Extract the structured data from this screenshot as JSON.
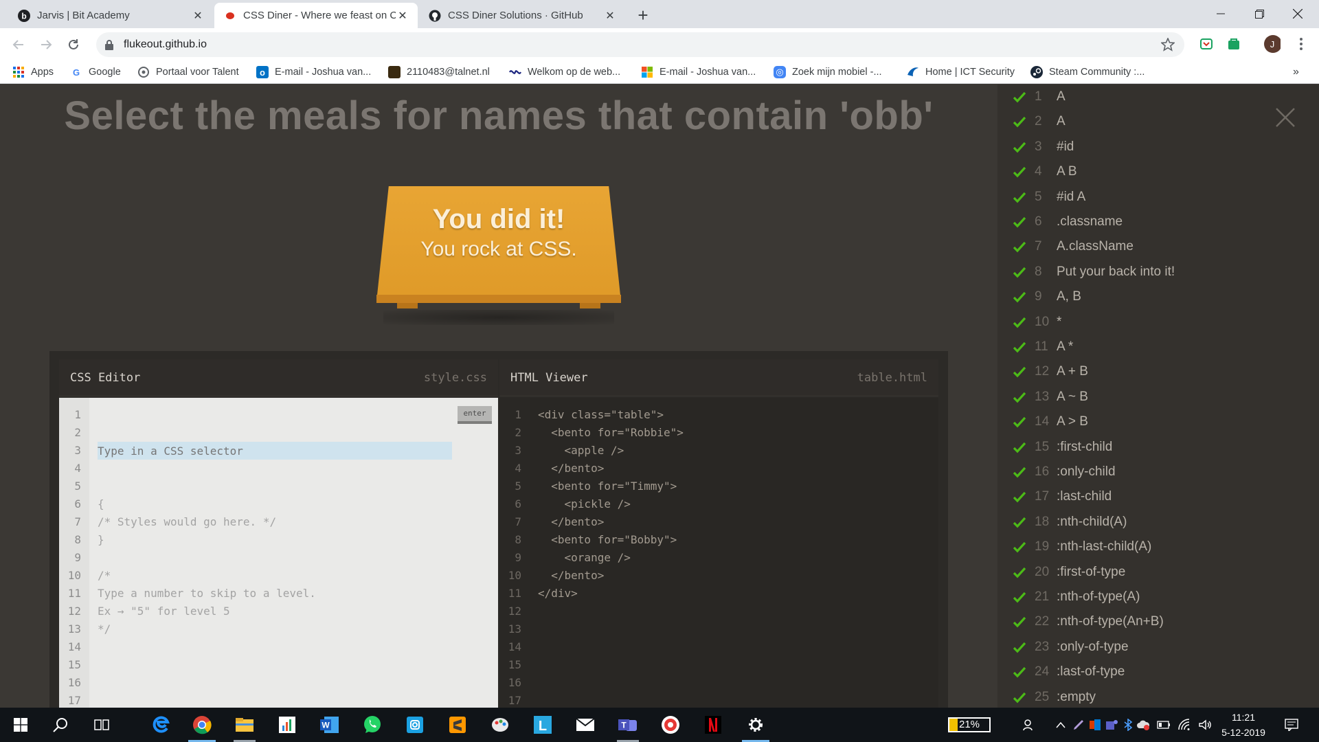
{
  "browser": {
    "tabs": [
      {
        "title": "Jarvis | Bit Academy",
        "icon": "bit-academy-icon",
        "active": false
      },
      {
        "title": "CSS Diner - Where we feast on C",
        "icon": "css-diner-icon",
        "active": true
      },
      {
        "title": "CSS Diner Solutions · GitHub",
        "icon": "github-icon",
        "active": false
      }
    ],
    "url": "flukeout.github.io",
    "profile_initial": "J",
    "bookmarks": [
      {
        "label": "Apps",
        "icon": "apps-grid-icon"
      },
      {
        "label": "Google",
        "icon": "google-icon"
      },
      {
        "label": "Portaal voor Talent",
        "icon": "portal-icon"
      },
      {
        "label": "E-mail - Joshua van...",
        "icon": "outlook-icon"
      },
      {
        "label": "2110483@talnet.nl",
        "icon": "talnet-icon"
      },
      {
        "label": "Welkom op de web...",
        "icon": "web-icon"
      },
      {
        "label": "E-mail - Joshua van...",
        "icon": "microsoft-icon"
      },
      {
        "label": "Zoek mijn mobiel -...",
        "icon": "find-phone-icon"
      },
      {
        "label": "Home | ICT Security",
        "icon": "ict-security-icon"
      },
      {
        "label": "Steam Community :...",
        "icon": "steam-icon"
      }
    ]
  },
  "game": {
    "order": "Select the meals for names that contain 'obb'",
    "plate_line1": "You did it!",
    "plate_line2": "You rock at CSS.",
    "css_editor": {
      "title": "CSS Editor",
      "file": "style.css",
      "placeholder": "Type in a CSS selector",
      "enter_label": "enter",
      "lines": [
        "{",
        "/* Styles would go here. */",
        "}",
        "",
        "/*",
        "Type a number to skip to a level.",
        "Ex → \"5\" for level 5",
        "*/"
      ]
    },
    "html_viewer": {
      "title": "HTML Viewer",
      "file": "table.html",
      "lines": [
        "<div class=\"table\">",
        "  <bento for=\"Robbie\">",
        "    <apple />",
        "  </bento>",
        "  <bento for=\"Timmy\">",
        "    <pickle />",
        "  </bento>",
        "  <bento for=\"Bobby\">",
        "    <orange />",
        "  </bento>",
        "</div>"
      ]
    },
    "line_numbers": [
      "1",
      "2",
      "3",
      "4",
      "5",
      "6",
      "7",
      "8",
      "9",
      "10",
      "11",
      "12",
      "13",
      "14",
      "15",
      "16",
      "17"
    ],
    "levels": [
      {
        "n": "1",
        "label": "A"
      },
      {
        "n": "2",
        "label": "A"
      },
      {
        "n": "3",
        "label": "#id"
      },
      {
        "n": "4",
        "label": "A  B"
      },
      {
        "n": "5",
        "label": "#id  A"
      },
      {
        "n": "6",
        "label": ".classname"
      },
      {
        "n": "7",
        "label": "A.className"
      },
      {
        "n": "8",
        "label": "Put your back into it!"
      },
      {
        "n": "9",
        "label": "A, B"
      },
      {
        "n": "10",
        "label": "*"
      },
      {
        "n": "11",
        "label": "A  *"
      },
      {
        "n": "12",
        "label": "A + B"
      },
      {
        "n": "13",
        "label": "A ~ B"
      },
      {
        "n": "14",
        "label": "A > B"
      },
      {
        "n": "15",
        "label": ":first-child"
      },
      {
        "n": "16",
        "label": ":only-child"
      },
      {
        "n": "17",
        "label": ":last-child"
      },
      {
        "n": "18",
        "label": ":nth-child(A)"
      },
      {
        "n": "19",
        "label": ":nth-last-child(A)"
      },
      {
        "n": "20",
        "label": ":first-of-type"
      },
      {
        "n": "21",
        "label": ":nth-of-type(A)"
      },
      {
        "n": "22",
        "label": ":nth-of-type(An+B)"
      },
      {
        "n": "23",
        "label": ":only-of-type"
      },
      {
        "n": "24",
        "label": ":last-of-type"
      },
      {
        "n": "25",
        "label": ":empty"
      }
    ],
    "check_color": "#4cbb17"
  },
  "taskbar": {
    "battery": "21%",
    "battery_level": 0.21,
    "time": "11:21",
    "date": "5-12-2019"
  }
}
